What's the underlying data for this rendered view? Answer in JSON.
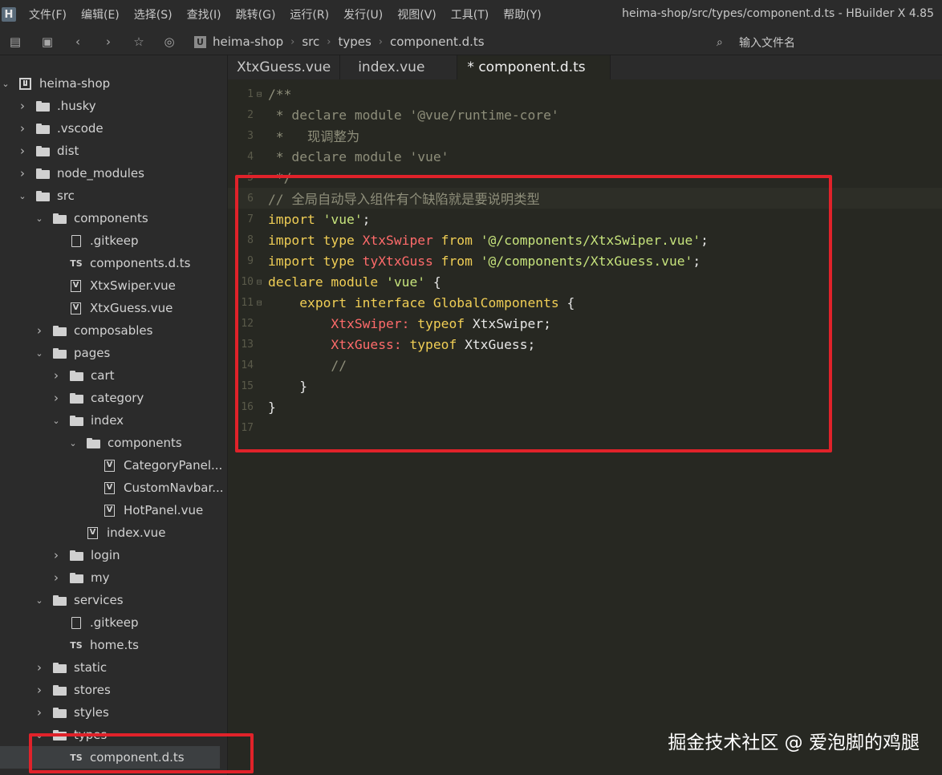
{
  "menubar": {
    "logo": "H",
    "items": [
      "文件(F)",
      "编辑(E)",
      "选择(S)",
      "查找(I)",
      "跳转(G)",
      "运行(R)",
      "发行(U)",
      "视图(V)",
      "工具(T)",
      "帮助(Y)"
    ],
    "window_title": "heima-shop/src/types/component.d.ts - HBuilder X 4.85"
  },
  "toolbar": {
    "icons": [
      "collapse-icon",
      "save-icon",
      "back-icon",
      "forward-icon",
      "star-icon",
      "run-icon"
    ],
    "breadcrumb": [
      "heima-shop",
      "src",
      "types",
      "component.d.ts"
    ],
    "file_search_placeholder": "输入文件名"
  },
  "sidebar": {
    "items": [
      {
        "label": "heima-shop",
        "kind": "project",
        "expanded": true
      },
      {
        "label": ".husky",
        "kind": "folder",
        "expanded": false
      },
      {
        "label": ".vscode",
        "kind": "folder",
        "expanded": false
      },
      {
        "label": "dist",
        "kind": "folder",
        "expanded": false
      },
      {
        "label": "node_modules",
        "kind": "folder",
        "expanded": false
      },
      {
        "label": "src",
        "kind": "folder",
        "expanded": true
      },
      {
        "label": "components",
        "kind": "folder",
        "expanded": true
      },
      {
        "label": ".gitkeep",
        "kind": "file"
      },
      {
        "label": "components.d.ts",
        "kind": "ts"
      },
      {
        "label": "XtxSwiper.vue",
        "kind": "vue"
      },
      {
        "label": "XtxGuess.vue",
        "kind": "vue"
      },
      {
        "label": "composables",
        "kind": "folder",
        "expanded": false
      },
      {
        "label": "pages",
        "kind": "folder",
        "expanded": true
      },
      {
        "label": "cart",
        "kind": "folder",
        "expanded": false
      },
      {
        "label": "category",
        "kind": "folder",
        "expanded": false
      },
      {
        "label": "index",
        "kind": "folder",
        "expanded": true
      },
      {
        "label": "components",
        "kind": "folder",
        "expanded": true
      },
      {
        "label": "CategoryPanel...",
        "kind": "vue"
      },
      {
        "label": "CustomNavbar...",
        "kind": "vue"
      },
      {
        "label": "HotPanel.vue",
        "kind": "vue"
      },
      {
        "label": "index.vue",
        "kind": "vue"
      },
      {
        "label": "login",
        "kind": "folder",
        "expanded": false
      },
      {
        "label": "my",
        "kind": "folder",
        "expanded": false
      },
      {
        "label": "services",
        "kind": "folder",
        "expanded": true
      },
      {
        "label": ".gitkeep",
        "kind": "file"
      },
      {
        "label": "home.ts",
        "kind": "ts"
      },
      {
        "label": "static",
        "kind": "folder",
        "expanded": false
      },
      {
        "label": "stores",
        "kind": "folder",
        "expanded": false
      },
      {
        "label": "styles",
        "kind": "folder",
        "expanded": false
      },
      {
        "label": "types",
        "kind": "folder",
        "expanded": true
      },
      {
        "label": "component.d.ts",
        "kind": "ts",
        "selected": true
      }
    ]
  },
  "tabs": [
    {
      "label": "XtxGuess.vue",
      "active": false
    },
    {
      "label": "index.vue",
      "active": false
    },
    {
      "label": "* component.d.ts",
      "active": true
    }
  ],
  "editor": {
    "lines": [
      {
        "n": "1",
        "fold": "⊟",
        "parts": [
          {
            "t": "/**",
            "c": "c-comment"
          }
        ]
      },
      {
        "n": "2",
        "fold": "",
        "parts": [
          {
            "t": " * declare module '@vue/runtime-core'",
            "c": "c-comment"
          }
        ]
      },
      {
        "n": "3",
        "fold": "",
        "parts": [
          {
            "t": " *   现调整为",
            "c": "c-comment"
          }
        ]
      },
      {
        "n": "4",
        "fold": "",
        "parts": [
          {
            "t": " * declare module 'vue'",
            "c": "c-comment"
          }
        ]
      },
      {
        "n": "5",
        "fold": "",
        "parts": [
          {
            "t": " */",
            "c": "c-comment"
          }
        ]
      },
      {
        "n": "6",
        "fold": "",
        "current": true,
        "parts": [
          {
            "t": "// 全局自动导入组件有个缺陷就是要说明类型",
            "c": "c-comment"
          }
        ]
      },
      {
        "n": "7",
        "fold": "",
        "parts": [
          {
            "t": "import ",
            "c": "c-kw"
          },
          {
            "t": "'vue'",
            "c": "c-str"
          },
          {
            "t": ";",
            "c": "c-plain"
          }
        ]
      },
      {
        "n": "8",
        "fold": "",
        "parts": [
          {
            "t": "import type ",
            "c": "c-kw"
          },
          {
            "t": "XtxSwiper ",
            "c": "c-red"
          },
          {
            "t": "from ",
            "c": "c-kw"
          },
          {
            "t": "'@/components/XtxSwiper.vue'",
            "c": "c-str"
          },
          {
            "t": ";",
            "c": "c-plain"
          }
        ]
      },
      {
        "n": "9",
        "fold": "",
        "parts": [
          {
            "t": "import type ",
            "c": "c-kw"
          },
          {
            "t": "tyXtxGuss ",
            "c": "c-red"
          },
          {
            "t": "from ",
            "c": "c-kw"
          },
          {
            "t": "'@/components/XtxGuess.vue'",
            "c": "c-str"
          },
          {
            "t": ";",
            "c": "c-plain"
          }
        ]
      },
      {
        "n": "10",
        "fold": "⊟",
        "parts": [
          {
            "t": "declare module ",
            "c": "c-kw"
          },
          {
            "t": "'vue'",
            "c": "c-str"
          },
          {
            "t": " {",
            "c": "c-plain"
          }
        ]
      },
      {
        "n": "11",
        "fold": "⊟",
        "parts": [
          {
            "t": "    export interface ",
            "c": "c-kw"
          },
          {
            "t": "GlobalComponents",
            "c": "c-kw"
          },
          {
            "t": " {",
            "c": "c-plain"
          }
        ]
      },
      {
        "n": "12",
        "fold": "",
        "parts": [
          {
            "t": "        XtxSwiper: ",
            "c": "c-red"
          },
          {
            "t": "typeof ",
            "c": "c-kw"
          },
          {
            "t": "XtxSwiper;",
            "c": "c-plain"
          }
        ]
      },
      {
        "n": "13",
        "fold": "",
        "parts": [
          {
            "t": "        XtxGuess: ",
            "c": "c-red"
          },
          {
            "t": "typeof ",
            "c": "c-kw"
          },
          {
            "t": "XtxGuess;",
            "c": "c-plain"
          }
        ]
      },
      {
        "n": "14",
        "fold": "",
        "parts": [
          {
            "t": "        //",
            "c": "c-comment"
          }
        ]
      },
      {
        "n": "15",
        "fold": "",
        "parts": [
          {
            "t": "    }",
            "c": "c-plain"
          }
        ]
      },
      {
        "n": "16",
        "fold": "",
        "parts": [
          {
            "t": "}",
            "c": "c-plain"
          }
        ]
      },
      {
        "n": "17",
        "fold": "",
        "parts": []
      }
    ]
  },
  "watermark": "掘金技术社区 @ 爱泡脚的鸡腿",
  "colors": {
    "highlight": "#e0222a",
    "keyword": "#f0ce55",
    "string": "#c6e37c",
    "identifier": "#ff6b6b",
    "comment": "#8e8e7a"
  }
}
